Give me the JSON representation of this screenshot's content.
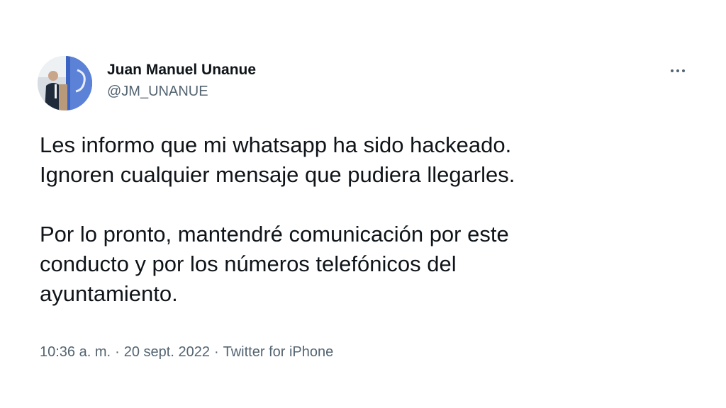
{
  "author": {
    "display_name": "Juan Manuel Unanue",
    "handle": "@JM_UNANUE"
  },
  "tweet": {
    "paragraphs": [
      [
        "Les informo que mi whatsapp ha sido hackeado.",
        "Ignoren cualquier mensaje que pudiera llegarles."
      ],
      [
        "Por lo pronto, mantendré comunicación por este",
        "conducto y por los números telefónicos del",
        "ayuntamiento."
      ]
    ]
  },
  "meta": {
    "time": "10:36 a. m.",
    "separator": "·",
    "date": "20 sept. 2022",
    "source": "Twitter for iPhone"
  },
  "icons": {
    "more": "more-horizontal-icon",
    "avatar": "profile-photo"
  },
  "colors": {
    "text": "#0f1419",
    "secondary": "#536471",
    "avatar_accent": "#3b63c4"
  }
}
